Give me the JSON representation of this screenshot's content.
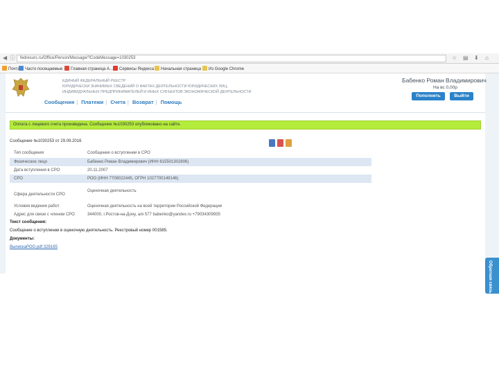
{
  "browser": {
    "url": "fedresurs.ru/Office/Person/Message/?CodeMessage=1030253",
    "bookmarks": [
      "Почта",
      "Часто посещаемые",
      "Главная страница А...",
      "Сервисы Яндекса",
      "Начальная страница",
      "Из Google Chrome"
    ]
  },
  "header": {
    "registry_lines": [
      "Единый федеральный реестр",
      "юридически значимых сведений о фактах деятельности юридических лиц,",
      "индивидуальных предпринимателей и иных субъектов экономической деятельности"
    ],
    "menu": [
      "Сообщения",
      "Платежи",
      "Счета",
      "Возврат",
      "Помощь"
    ],
    "user_name": "Бабенко Роман Владимирович",
    "balance": "На вс 0,00р",
    "topup_label": "Пополнить",
    "logout_label": "Выйти"
  },
  "notice": "Оплата с лицевого счета произведена. Сообщение №1030253 опубликовано на сайте.",
  "message_number": "Сообщение №1030253 от 29.09.2016",
  "details": [
    {
      "label": "Тип сообщения",
      "value": "Сообщение о вступлении в СРО"
    },
    {
      "label": "Физическое лицо",
      "value": "Бабенко Роман Владимирович (ИНН 615501302806)"
    },
    {
      "label": "Дата вступления в СРО",
      "value": "20.11.2007"
    },
    {
      "label": "СРО",
      "value": "РОО (ИНН 7708022445, ОГРН 1027700149146)"
    },
    {
      "label": "Сфера деятельности СРО",
      "value": "Оценочная деятельность"
    },
    {
      "label": "Условия ведения работ",
      "value": "Оценочная деятельность на всей территории Российской Федерации"
    },
    {
      "label": "Адрес для связи с членом СРО",
      "value": "344000, г.Ростов-на-Дону, а/я 577 babenko@yandex.ru +79034309935"
    }
  ],
  "text_section": {
    "title": "Текст сообщения:",
    "body": "Сообщение о вступлении в оценочную деятельность. Реестровый номер 001585.",
    "docs_title": "Документы:",
    "doc_link": "ВыпискаРОО.pdf 329165"
  },
  "feedback_label": "Обратная связь",
  "colors": {
    "accent": "#2b82c9",
    "notice": "#b4ec3c",
    "row_alt": "#dde7f3"
  }
}
